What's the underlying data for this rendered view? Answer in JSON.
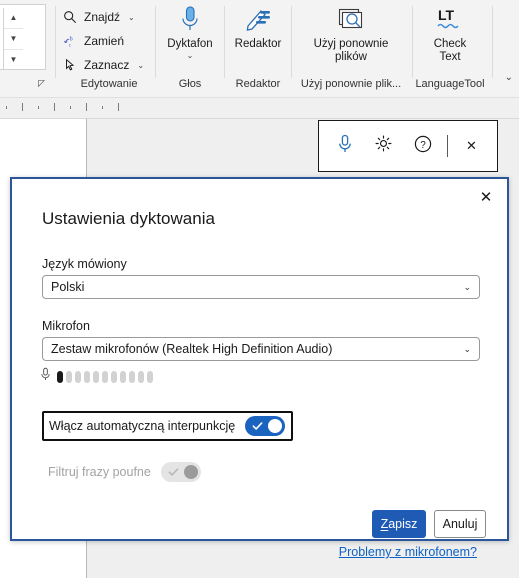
{
  "ribbon": {
    "groups": [
      {
        "label": "Edytowanie"
      },
      {
        "label": "Głos"
      },
      {
        "label": "Redaktor"
      },
      {
        "label": "Użyj ponownie plik..."
      },
      {
        "label": "LanguageTool"
      }
    ],
    "editing": {
      "find_label": "Znajdź",
      "replace_label": "Zamień",
      "select_label": "Zaznacz",
      "find_icon": "search-icon",
      "replace_icon": "replace-icon",
      "select_icon": "pointer-icon",
      "dialog_launcher_icon": "dialog-launcher-icon"
    },
    "voice": {
      "dictate_label": "Dyktafon",
      "dictate_icon": "microphone-icon"
    },
    "editor": {
      "editor_label": "Redaktor",
      "editor_icon": "pen-editor-icon"
    },
    "reuse": {
      "reuse_label_line1": "Użyj ponownie",
      "reuse_label_line2": "plików",
      "reuse_icon": "reuse-files-icon"
    },
    "languagetool": {
      "check_label_line1": "Check",
      "check_label_line2": "Text",
      "check_icon": "languagetool-lt-icon"
    },
    "collapse_icon": "chevron-down-icon",
    "caret_glyph": "⌄"
  },
  "dictation_toolbar": {
    "mic_icon": "microphone-icon",
    "settings_icon": "gear-icon",
    "help_icon": "help-circle-icon",
    "close_icon": "close-icon",
    "close_glyph": "✕"
  },
  "dialog": {
    "title": "Ustawienia dyktowania",
    "close_glyph": "✕",
    "language": {
      "label": "Język mówiony",
      "value": "Polski",
      "caret_glyph": "⌄"
    },
    "microphone": {
      "label": "Mikrofon",
      "value": "Zestaw mikrofonów (Realtek High Definition Audio)",
      "caret_glyph": "⌄"
    },
    "level_meter": {
      "icon": "microphone-small-icon",
      "total_dots": 11,
      "active_dots": 1
    },
    "mic_help_link": "Problemy z mikrofonem?",
    "auto_punctuation": {
      "label": "Włącz automatyczną interpunkcję",
      "state": "on",
      "focused": true
    },
    "filter_profanity": {
      "label": "Filtruj frazy poufne",
      "state": "off",
      "disabled": true
    },
    "save_button": {
      "prefix": "Z",
      "rest": "apisz"
    },
    "cancel_button": "Anuluj",
    "accent_color": "#1f5bb5",
    "border_color": "#2b579a",
    "link_color": "#0f62c4"
  }
}
